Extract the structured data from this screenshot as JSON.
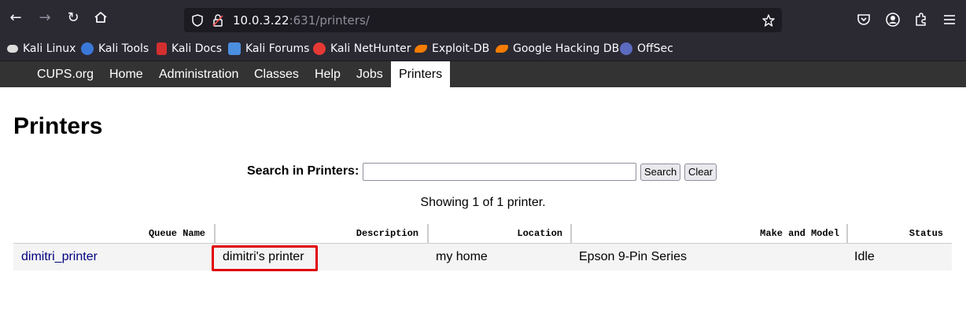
{
  "browser": {
    "url_host": "10.0.3.22",
    "url_rest": ":631/printers/",
    "bookmarks": [
      {
        "label": "Kali Linux",
        "icon": "kali-dragon-icon",
        "color": "#dddddd"
      },
      {
        "label": "Kali Tools",
        "icon": "kali-tools-icon",
        "color": "#3a78d8"
      },
      {
        "label": "Kali Docs",
        "icon": "kali-docs-icon",
        "color": "#d32f2f"
      },
      {
        "label": "Kali Forums",
        "icon": "kali-forums-icon",
        "color": "#4a8fe0"
      },
      {
        "label": "Kali NetHunter",
        "icon": "nethunter-icon",
        "color": "#e53935"
      },
      {
        "label": "Exploit-DB",
        "icon": "exploit-db-icon",
        "color": "#f57c00"
      },
      {
        "label": "Google Hacking DB",
        "icon": "ghdb-icon",
        "color": "#f57c00"
      },
      {
        "label": "OffSec",
        "icon": "offsec-icon",
        "color": "#5c6bc0"
      }
    ]
  },
  "cups_nav": {
    "items": [
      {
        "label": "CUPS.org"
      },
      {
        "label": "Home"
      },
      {
        "label": "Administration"
      },
      {
        "label": "Classes"
      },
      {
        "label": "Help"
      },
      {
        "label": "Jobs"
      },
      {
        "label": "Printers",
        "active": true
      }
    ]
  },
  "page": {
    "title": "Printers",
    "search_label": "Search in Printers:",
    "search_value": "",
    "search_button": "Search",
    "clear_button": "Clear",
    "showing_text": "Showing 1 of 1 printer."
  },
  "table": {
    "headers": [
      "Queue Name",
      "Description",
      "Location",
      "Make and Model",
      "Status"
    ],
    "rows": [
      {
        "queue_name": "dimitri_printer",
        "description": "dimitri's printer",
        "location": "my home",
        "make_model": "Epson 9-Pin Series",
        "status": "Idle"
      }
    ]
  },
  "colors": {
    "highlight": "#e00000",
    "link": "#000080",
    "nav_bg": "#333333"
  }
}
